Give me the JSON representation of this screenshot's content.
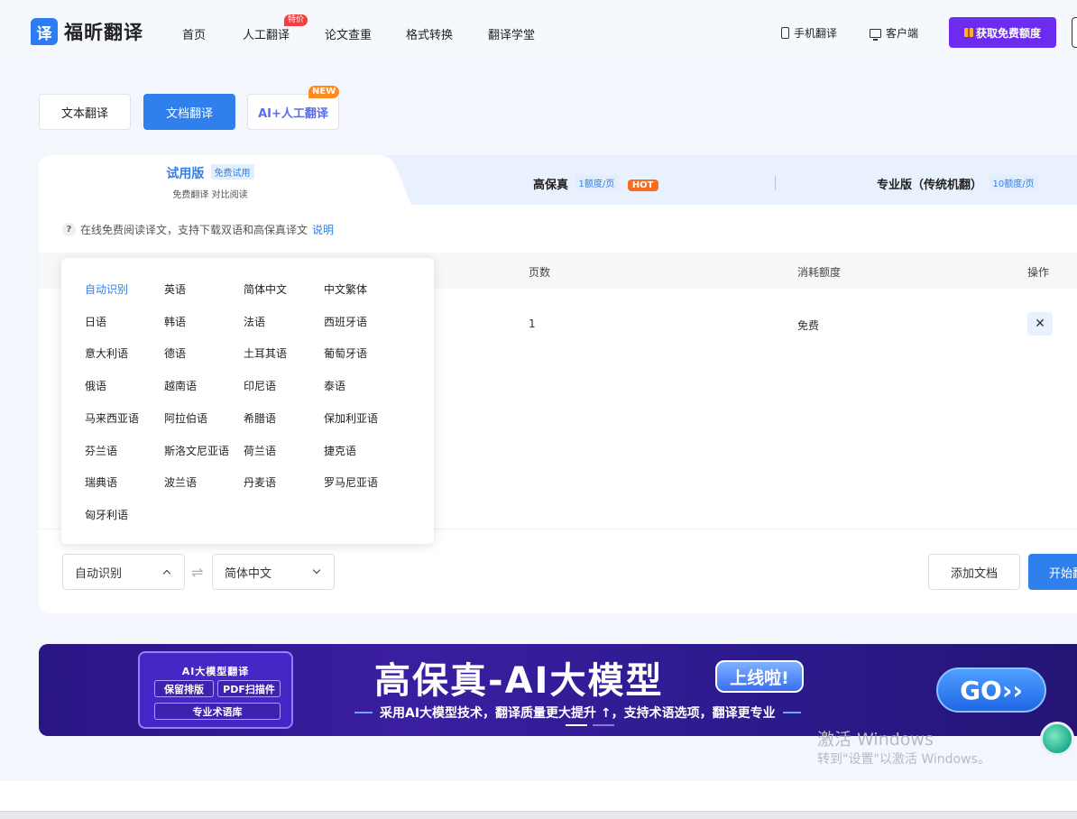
{
  "header": {
    "logo_mark": "译",
    "logo_text": "福昕翻译",
    "nav": [
      {
        "label": "首页"
      },
      {
        "label": "人工翻译",
        "badge": "特价"
      },
      {
        "label": "论文查重"
      },
      {
        "label": "格式转换"
      },
      {
        "label": "翻译学堂"
      }
    ],
    "mobile_link": "手机翻译",
    "client_link": "客户端",
    "cta_label": "获取免费额度"
  },
  "modes": {
    "text": "文本翻译",
    "document": "文档翻译",
    "ai": "AI+人工翻译",
    "ai_badge": "NEW"
  },
  "tiers": {
    "trial": {
      "title": "试用版",
      "tag": "免费试用",
      "sub": "免费翻译 对比阅读"
    },
    "hifi": {
      "title": "高保真",
      "tag": "1额度/页",
      "badge": "HOT"
    },
    "pro": {
      "title": "专业版（传统机翻）",
      "tag": "10额度/页"
    }
  },
  "hint": {
    "icon": "?",
    "text": "在线免费阅读译文，支持下载双语和高保真译文",
    "link": "说明"
  },
  "table": {
    "headers": {
      "pages": "页数",
      "cost": "消耗额度",
      "action": "操作"
    },
    "rows": [
      {
        "pages": "1",
        "cost": "免费",
        "delete": "✕"
      }
    ]
  },
  "languages": [
    "自动识别",
    "英语",
    "简体中文",
    "中文繁体",
    "日语",
    "韩语",
    "法语",
    "西班牙语",
    "意大利语",
    "德语",
    "土耳其语",
    "葡萄牙语",
    "俄语",
    "越南语",
    "印尼语",
    "泰语",
    "马来西亚语",
    "阿拉伯语",
    "希腊语",
    "保加利亚语",
    "芬兰语",
    "斯洛文尼亚语",
    "荷兰语",
    "捷克语",
    "瑞典语",
    "波兰语",
    "丹麦语",
    "罗马尼亚语",
    "匈牙利语"
  ],
  "selected_language_index": 0,
  "controls": {
    "source_lang": "自动识别",
    "swap": "⇌",
    "target_lang": "简体中文",
    "add_doc": "添加文档",
    "start": "开始翻译"
  },
  "banner": {
    "chip_title": "AI大模型翻译",
    "chip_a": "保留排版",
    "chip_b": "PDF扫描件",
    "chip_c": "专业术语库",
    "headline": "高保真-AI大模型",
    "badge": "上线啦!",
    "sub": "采用AI大模型技术，翻译质量更大提升 ↑，支持术语选项，翻译更专业",
    "go": "GO››"
  },
  "os_watermark": {
    "line1": "激活 Windows",
    "line2": "转到\"设置\"以激活 Windows。"
  },
  "colors": {
    "primary": "#2f80ed",
    "cta": "#6d2bf0",
    "hot": "#f86d1b",
    "banner": "#2a1584"
  }
}
